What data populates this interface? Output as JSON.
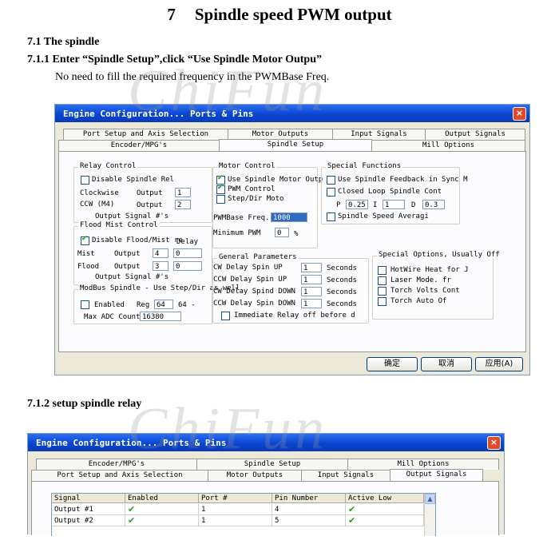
{
  "doc": {
    "chapter_num": "7",
    "chapter_title": "Spindle speed PWM output",
    "sec_7_1": "7.1 The spindle",
    "sec_7_1_1": "7.1.1 Enter “Spindle Setup”,click “Use Spindle Motor Outpu”",
    "note": "No need to fill the required frequency in the PWMBase Freq.",
    "sec_7_1_2": "7.1.2 setup spindle relay",
    "watermark": "ChiFun"
  },
  "dialog1": {
    "title": "Engine Configuration... Ports & Pins",
    "close": "×",
    "tabs_back": [
      "Port Setup and Axis Selection",
      "Motor Outputs",
      "Input Signals",
      "Output Signals"
    ],
    "tabs_front": [
      "Encoder/MPG's",
      "Spindle Setup",
      "Mill Options"
    ],
    "relay": {
      "legend": "Relay Control",
      "disable": "Disable Spindle Rel",
      "cw_label": "Clockwise",
      "ccw_label": "CCW  (M4)",
      "output_label": "Output",
      "cw_value": "1",
      "ccw_value": "2",
      "signal": "Output Signal #'s"
    },
    "flood": {
      "legend": "Flood Mist Control",
      "disable": "Disable Flood/Mist re",
      "delay": "Delay",
      "mist": "Mist",
      "flood": "Flood",
      "output_label": "Output",
      "mist_value": "4",
      "flood_value": "3",
      "mist_delay": "0",
      "flood_delay": "0",
      "signal": "Output Signal #'s"
    },
    "modbus": {
      "legend": "ModBus Spindle - Use Step/Dir as well",
      "enabled": "Enabled",
      "reg": "Reg",
      "reg_value": "64",
      "reg_value2": "64 -",
      "max_adc": "Max ADC Count",
      "max_adc_value": "16380"
    },
    "motor": {
      "legend": "Motor Control",
      "use_motor": "Use Spindle Motor Outp",
      "pwm": "PWM Control",
      "stepdir": "Step/Dir Moto",
      "pwm_base": "PWMBase Freq.",
      "pwm_base_value": "1000",
      "min_pwm": "Minimum PWM",
      "min_pwm_value": "0",
      "min_pwm_unit": "%"
    },
    "general": {
      "legend": "General Parameters",
      "rows": [
        {
          "label": "CW Delay Spin UP",
          "value": "1",
          "unit": "Seconds"
        },
        {
          "label": "CCW Delay Spin UP",
          "value": "1",
          "unit": "Seconds"
        },
        {
          "label": "CW Delay Spind DOWN",
          "value": "1",
          "unit": "Seconds"
        },
        {
          "label": "CCW Delay Spin DOWN",
          "value": "1",
          "unit": "Seconds"
        }
      ],
      "immediate": "Immediate Relay off before d"
    },
    "special_funcs": {
      "legend": "Special Functions",
      "feedback": "Use Spindle Feedback in Sync M",
      "closed_loop": "Closed Loop Spindle Cont",
      "p": "P",
      "p_value": "0.25",
      "i": "I",
      "i_value": "1",
      "d": "D",
      "d_value": "0.3",
      "averaging": "Spindle Speed Averagi"
    },
    "special_opts": {
      "legend": "Special Options, Usually Off",
      "items": [
        "HotWire Heat for J",
        "Laser Mode. fr",
        "Torch Volts Cont",
        "Torch Auto Of"
      ]
    },
    "buttons": {
      "ok": "确定",
      "cancel": "取消",
      "apply": "应用(A)"
    }
  },
  "dialog2": {
    "title": "Engine Configuration... Ports & Pins",
    "close": "×",
    "tabs_back": [
      "Encoder/MPG's",
      "Spindle Setup",
      "Mill Options"
    ],
    "tabs_front": [
      "Port Setup and Axis Selection",
      "Motor Outputs",
      "Input Signals",
      "Output Signals"
    ],
    "table": {
      "headers": [
        "Signal",
        "Enabled",
        "Port #",
        "Pin Number",
        "Active Low"
      ],
      "rows": [
        {
          "signal": "Output #1",
          "enabled": "✔",
          "port": "1",
          "pin": "4",
          "active_low": "✔"
        },
        {
          "signal": "Output #2",
          "enabled": "✔",
          "port": "1",
          "pin": "5",
          "active_low": "✔"
        }
      ],
      "scroll_up": "▲"
    }
  }
}
